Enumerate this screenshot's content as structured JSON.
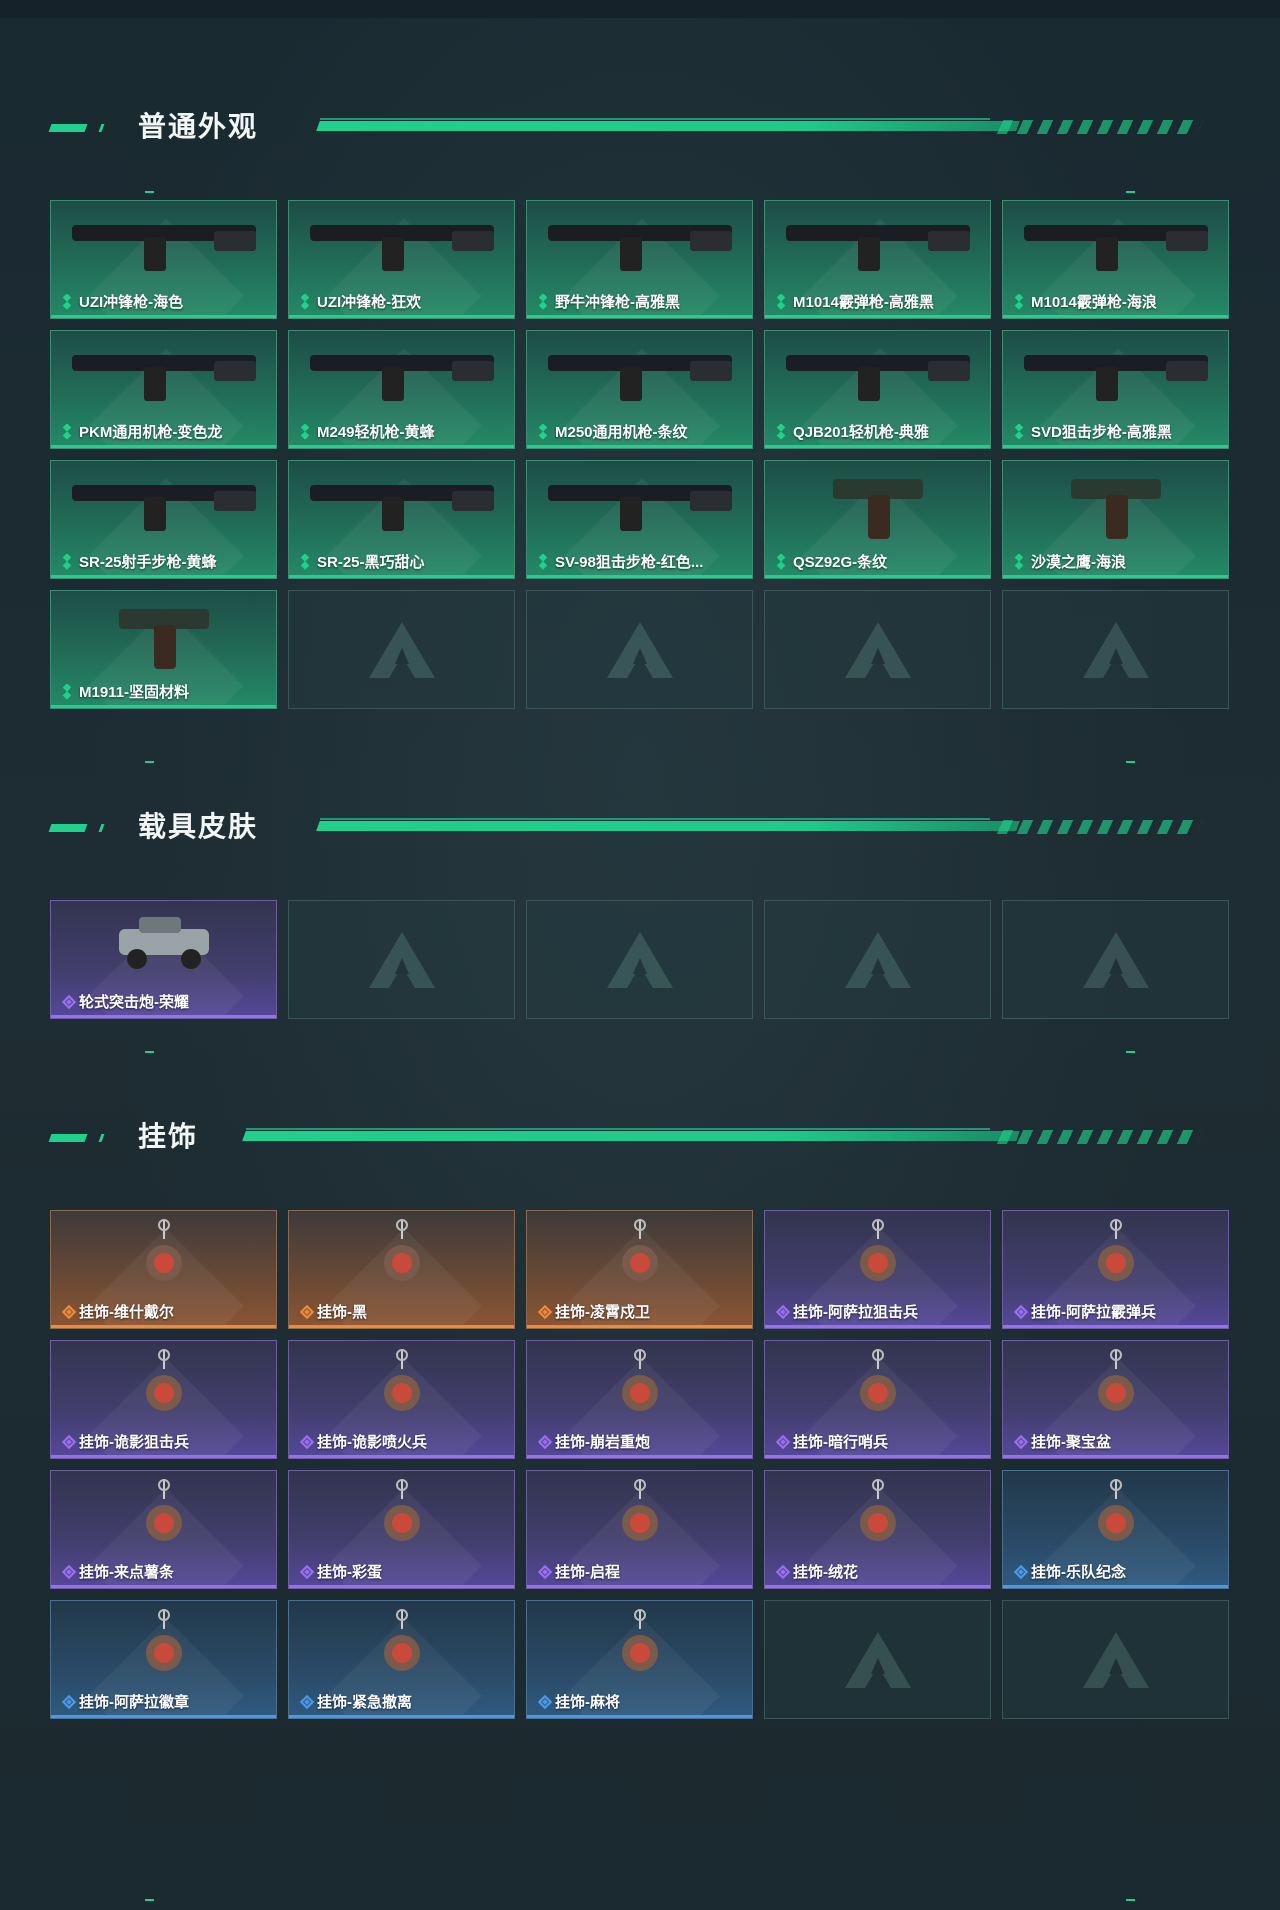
{
  "sections": [
    {
      "title": "普通外观",
      "items": [
        {
          "label": "UZI冲锋枪-海色",
          "rarity": "green",
          "icon": "uzi-blue-white-icon"
        },
        {
          "label": "UZI冲锋枪-狂欢",
          "rarity": "green",
          "icon": "uzi-carnival-icon"
        },
        {
          "label": "野牛冲锋枪-高雅黑",
          "rarity": "green",
          "icon": "bizon-smg-black-icon"
        },
        {
          "label": "M1014霰弹枪-高雅黑",
          "rarity": "green",
          "icon": "shotgun-black-icon"
        },
        {
          "label": "M1014霰弹枪-海浪",
          "rarity": "green",
          "icon": "shotgun-wave-icon"
        },
        {
          "label": "PKM通用机枪-变色龙",
          "rarity": "green",
          "icon": "pkm-machinegun-icon"
        },
        {
          "label": "M249轻机枪-黄蜂",
          "rarity": "green",
          "icon": "m249-hornet-icon"
        },
        {
          "label": "M250通用机枪-条纹",
          "rarity": "green",
          "icon": "m250-stripe-icon"
        },
        {
          "label": "QJB201轻机枪-典雅",
          "rarity": "green",
          "icon": "qjb201-icon"
        },
        {
          "label": "SVD狙击步枪-高雅黑",
          "rarity": "green",
          "icon": "svd-black-icon"
        },
        {
          "label": "SR-25射手步枪-黄蜂",
          "rarity": "green",
          "icon": "sr25-hornet-icon"
        },
        {
          "label": "SR-25-黑巧甜心",
          "rarity": "green",
          "icon": "sr25-pink-icon"
        },
        {
          "label": "SV-98狙击步枪-红色...",
          "rarity": "green",
          "icon": "sv98-red-icon"
        },
        {
          "label": "QSZ92G-条纹",
          "rarity": "green",
          "icon": "pistol-green-icon"
        },
        {
          "label": "沙漠之鹰-海浪",
          "rarity": "green",
          "icon": "desert-eagle-icon"
        },
        {
          "label": "M1911-坚固材料",
          "rarity": "green",
          "icon": "m1911-icon"
        },
        {
          "empty": true
        },
        {
          "empty": true
        },
        {
          "empty": true
        },
        {
          "empty": true
        }
      ]
    },
    {
      "title": "载具皮肤",
      "items": [
        {
          "label": "轮式突击炮-荣耀",
          "rarity": "purple",
          "icon": "armored-vehicle-icon"
        },
        {
          "empty": true
        },
        {
          "empty": true
        },
        {
          "empty": true
        },
        {
          "empty": true
        }
      ]
    },
    {
      "title": "挂饰",
      "items": [
        {
          "label": "挂饰-维什戴尔",
          "rarity": "orange",
          "icon": "charm-card-icon"
        },
        {
          "label": "挂饰-黑",
          "rarity": "orange",
          "icon": "charm-card-icon"
        },
        {
          "label": "挂饰-凌霄戍卫",
          "rarity": "orange",
          "icon": "charm-rocket-icon"
        },
        {
          "label": "挂饰-阿萨拉狙击兵",
          "rarity": "purple",
          "icon": "charm-soldier-icon"
        },
        {
          "label": "挂饰-阿萨拉霰弹兵",
          "rarity": "purple",
          "icon": "charm-soldier-icon"
        },
        {
          "label": "挂饰-诡影狙击兵",
          "rarity": "purple",
          "icon": "charm-ghost-icon"
        },
        {
          "label": "挂饰-诡影喷火兵",
          "rarity": "purple",
          "icon": "charm-ghost-icon"
        },
        {
          "label": "挂饰-崩岩重炮",
          "rarity": "purple",
          "icon": "charm-rock-icon"
        },
        {
          "label": "挂饰-暗行哨兵",
          "rarity": "purple",
          "icon": "charm-sentry-icon"
        },
        {
          "label": "挂饰-聚宝盆",
          "rarity": "purple",
          "icon": "charm-treasure-icon"
        },
        {
          "label": "挂饰-来点薯条",
          "rarity": "purple",
          "icon": "charm-fries-icon"
        },
        {
          "label": "挂饰-彩蛋",
          "rarity": "purple",
          "icon": "charm-egg-icon"
        },
        {
          "label": "挂饰-启程",
          "rarity": "purple",
          "icon": "charm-medal-icon"
        },
        {
          "label": "挂饰-绒花",
          "rarity": "purple",
          "icon": "charm-flower-icon"
        },
        {
          "label": "挂饰-乐队纪念",
          "rarity": "blue",
          "icon": "charm-badge-icon"
        },
        {
          "label": "挂饰-阿萨拉徽章",
          "rarity": "blue",
          "icon": "charm-emblem-icon"
        },
        {
          "label": "挂饰-紧急撤离",
          "rarity": "blue",
          "icon": "charm-exit-icon"
        },
        {
          "label": "挂饰-麻将",
          "rarity": "blue",
          "icon": "charm-mahjong-icon"
        },
        {
          "empty": true
        },
        {
          "empty": true
        }
      ]
    }
  ],
  "colors": {
    "accent": "#21d08c",
    "green": "#22d08e",
    "purple": "#9a6ef0",
    "orange": "#f08a3a",
    "blue": "#4b9ae8"
  }
}
